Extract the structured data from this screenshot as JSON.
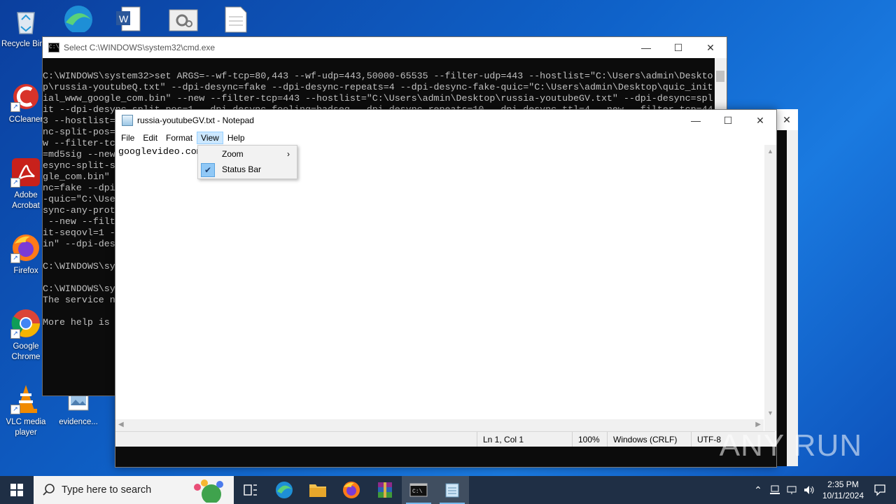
{
  "desktop_icons": [
    {
      "id": "recycle-bin",
      "label": "Recycle Bin"
    },
    {
      "id": "ccleaner",
      "label": "CCleaner"
    },
    {
      "id": "adobe-acrobat",
      "label": "Adobe Acrobat"
    },
    {
      "id": "firefox",
      "label": "Firefox"
    },
    {
      "id": "google-chrome",
      "label": "Google Chrome"
    },
    {
      "id": "vlc",
      "label": "VLC media player"
    },
    {
      "id": "evidence",
      "label": "evidence..."
    }
  ],
  "cmd": {
    "title": "Select C:\\WINDOWS\\system32\\cmd.exe",
    "lines": [
      "C:\\WINDOWS\\system32>set ARGS=--wf-tcp=80,443 --wf-udp=443,50000-65535 --filter-udp=443 --hostlist=\"C:\\Users\\admin\\Deskto",
      "p\\russia-youtubeQ.txt\" --dpi-desync=fake --dpi-desync-repeats=4 --dpi-desync-fake-quic=\"C:\\Users\\admin\\Desktop\\quic_init",
      "ial_www_google_com.bin\" --new --filter-tcp=443 --hostlist=\"C:\\Users\\admin\\Desktop\\russia-youtubeGV.txt\" --dpi-desync=spl",
      "it --dpi-desync-split-pos=1 --dpi-desync-fooling=badseq --dpi-desync-repeats=10 --dpi-desync-ttl=4 --new --filter-tcp=44",
      "3 --hostlist=",
      "nc-split-pos=",
      "w --filter-tc",
      "=md5sig --new",
      "esync-split-s",
      "gle_com.bin\"",
      "nc=fake --dpi",
      "-quic=\"C:\\Use",
      "sync-any-prot",
      " --new --filt",
      "it-seqovl=1 -",
      "in\" --dpi-des",
      "",
      "C:\\WINDOWS\\sy",
      "",
      "C:\\WINDOWS\\sy",
      "The service n",
      "",
      "More help is "
    ]
  },
  "notepad": {
    "title": "russia-youtubeGV.txt - Notepad",
    "menu": [
      "File",
      "Edit",
      "Format",
      "View",
      "Help"
    ],
    "content": "googlevideo.com",
    "status": {
      "position": "Ln 1, Col 1",
      "zoom": "100%",
      "eol": "Windows (CRLF)",
      "encoding": "UTF-8"
    }
  },
  "view_menu": {
    "items": [
      {
        "label": "Zoom",
        "has_submenu": true,
        "checked": false
      },
      {
        "label": "Status Bar",
        "has_submenu": false,
        "checked": true
      }
    ]
  },
  "watermark": "ANY RUN",
  "taskbar": {
    "search_placeholder": "Type here to search",
    "time": "2:35 PM",
    "date": "10/11/2024"
  },
  "colors": {
    "accent": "#0078d7",
    "menu_highlight": "#cce8ff",
    "taskbar": "#1f2f45"
  }
}
